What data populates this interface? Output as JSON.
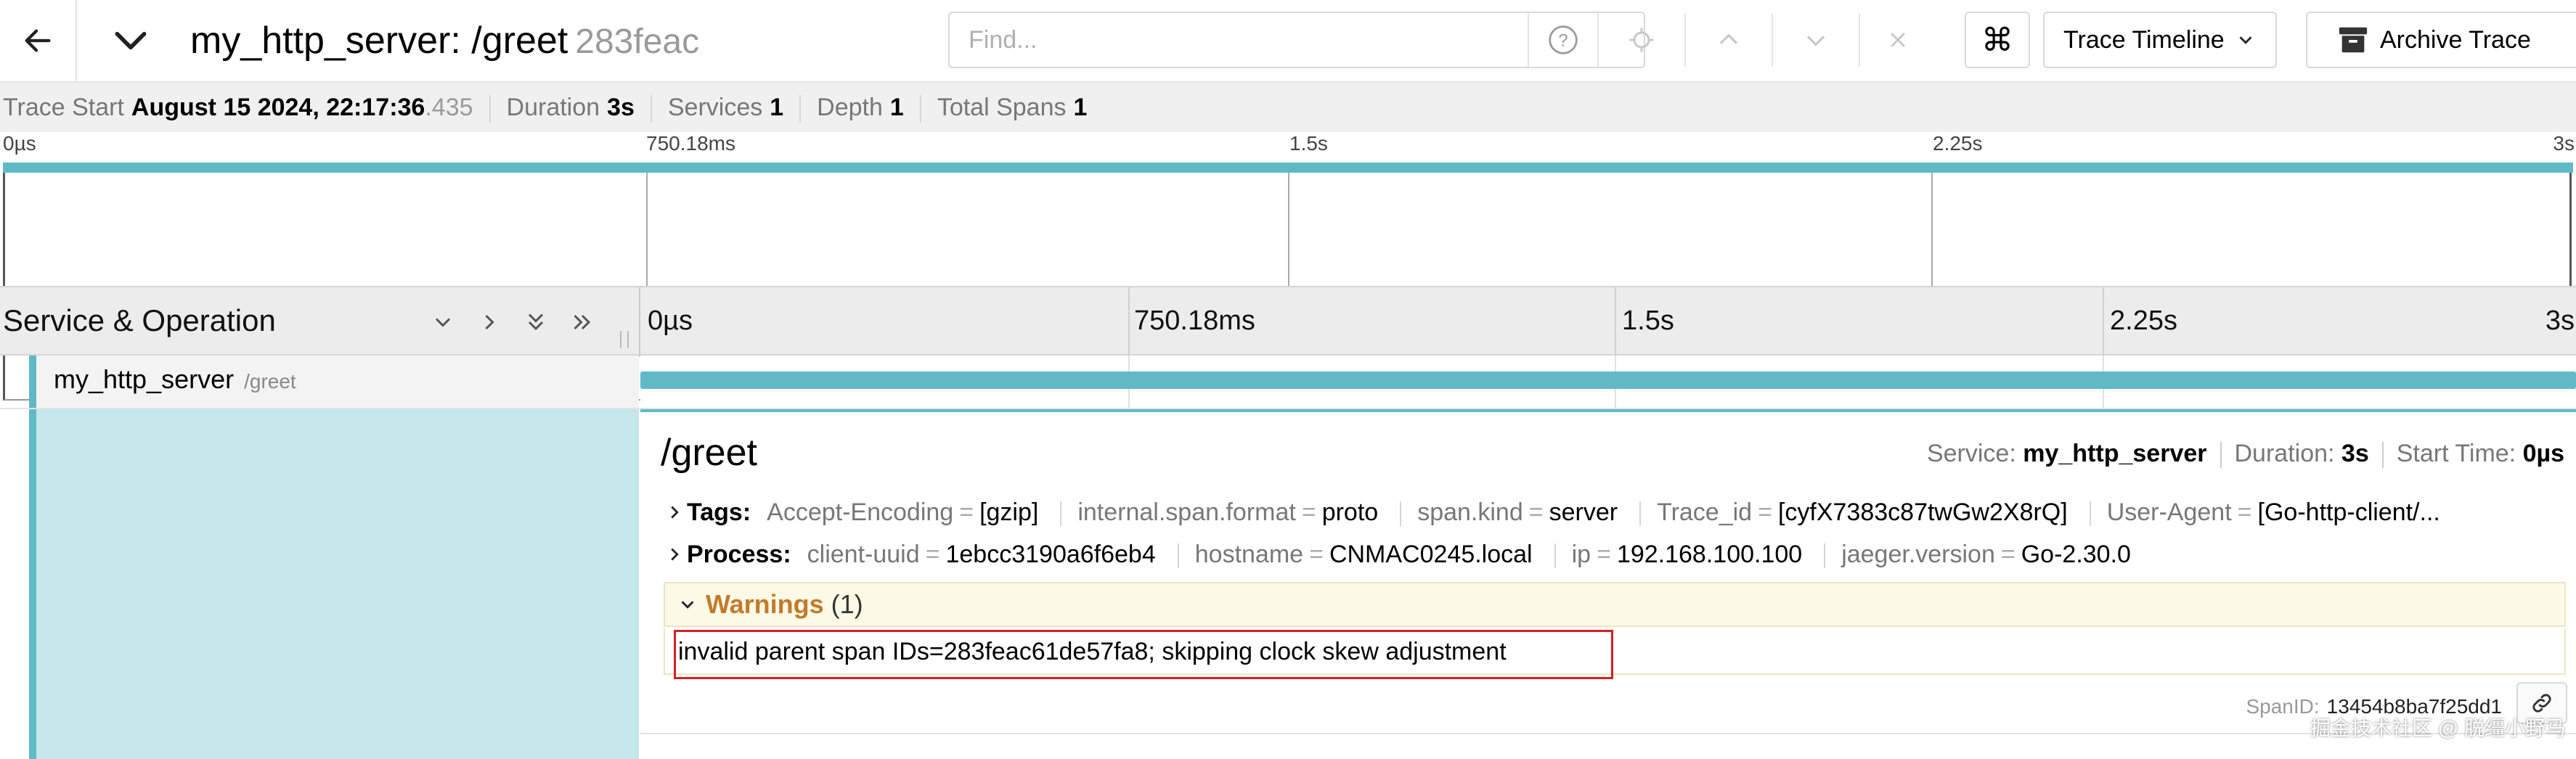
{
  "header": {
    "service": "my_http_server",
    "separator": ":",
    "operation": "/greet",
    "trace_id_short": "283feac",
    "find_placeholder": "Find...",
    "view_select_label": "Trace Timeline",
    "archive_label": "Archive Trace",
    "cmd_symbol": "⌘"
  },
  "summary": {
    "trace_start_label": "Trace Start",
    "trace_start_value": "August 15 2024, 22:17:36",
    "trace_start_ms": ".435",
    "duration_label": "Duration",
    "duration_value": "3s",
    "services_label": "Services",
    "services_value": "1",
    "depth_label": "Depth",
    "depth_value": "1",
    "total_spans_label": "Total Spans",
    "total_spans_value": "1"
  },
  "minimap": {
    "ticks": [
      "0µs",
      "750.18ms",
      "1.5s",
      "2.25s",
      "3s"
    ]
  },
  "timeline_header": {
    "title": "Service & Operation",
    "ticks": [
      "0µs",
      "750.18ms",
      "1.5s",
      "2.25s",
      "3s"
    ]
  },
  "span": {
    "service": "my_http_server",
    "operation": "/greet"
  },
  "detail": {
    "title": "/greet",
    "service_label": "Service:",
    "service_value": "my_http_server",
    "duration_label": "Duration:",
    "duration_value": "3s",
    "start_label": "Start Time:",
    "start_value": "0µs",
    "tags_label": "Tags:",
    "tags": [
      {
        "key": "Accept-Encoding",
        "value": "[gzip]"
      },
      {
        "key": "internal.span.format",
        "value": "proto"
      },
      {
        "key": "span.kind",
        "value": "server"
      },
      {
        "key": "Trace_id",
        "value": "[cyfX7383c87twGw2X8rQ]"
      },
      {
        "key": "User-Agent",
        "value": "[Go-http-client/..."
      }
    ],
    "process_label": "Process:",
    "process": [
      {
        "key": "client-uuid",
        "value": "1ebcc3190a6f6eb4"
      },
      {
        "key": "hostname",
        "value": "CNMAC0245.local"
      },
      {
        "key": "ip",
        "value": "192.168.100.100"
      },
      {
        "key": "jaeger.version",
        "value": "Go-2.30.0"
      }
    ],
    "warnings_label": "Warnings",
    "warnings_count": "(1)",
    "warnings": [
      "invalid parent span IDs=283feac61de57fa8; skipping clock skew adjustment"
    ],
    "span_id_label": "SpanID:",
    "span_id_value": "13454b8ba7f25dd1"
  },
  "watermark": "掘金技术社区 @ 脱缰小野马",
  "colors": {
    "accent": "#5fbac5",
    "span_detail_bg": "#c5e6ea",
    "warning_title": "#c17b2b",
    "highlight": "#d42020"
  }
}
